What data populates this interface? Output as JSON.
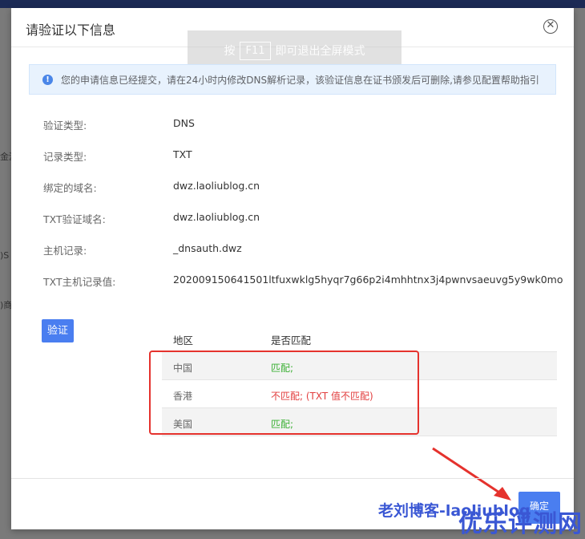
{
  "dialog": {
    "title": "请验证以下信息",
    "close_icon": "close-icon"
  },
  "fullscreen_tip": {
    "prefix": "按",
    "key": "F11",
    "suffix": "即可退出全屏模式"
  },
  "info_bar": {
    "icon": "info-icon",
    "text": "您的申请信息已经提交，请在24小时内修改DNS解析记录，该验证信息在证书颁发后可删除,请参见配置帮助指引"
  },
  "fields": [
    {
      "label": "验证类型:",
      "value": "DNS"
    },
    {
      "label": "记录类型:",
      "value": "TXT"
    },
    {
      "label": "绑定的域名:",
      "value": "dwz.laoliublog.cn"
    },
    {
      "label": "TXT验证域名:",
      "value": "dwz.laoliublog.cn"
    },
    {
      "label": "主机记录:",
      "value": "_dnsauth.dwz"
    },
    {
      "label": "TXT主机记录值:",
      "value": "202009150641501ltfuxwklg5hyqr7g66p2i4mhhtnx3j4pwnvsaeuvg5y9wk0mo"
    }
  ],
  "verify_button": "验证",
  "results_table": {
    "headers": [
      "地区",
      "是否匹配"
    ],
    "rows": [
      {
        "region": "中国",
        "status": "匹配;",
        "matched": true
      },
      {
        "region": "香港",
        "status": "不匹配; (TXT 值不匹配)",
        "matched": false
      },
      {
        "region": "美国",
        "status": "匹配;",
        "matched": true
      }
    ]
  },
  "confirm_button": "确定",
  "watermark": {
    "line1": "老刘博客-laoliublog",
    "line2": "优乐评测网"
  },
  "background_fragments": {
    "left1": "金源",
    "left2": ")S",
    "left3": ")商"
  },
  "colors": {
    "primary": "#4a7ef0",
    "match": "#3cb035",
    "nomatch": "#e23e3e",
    "annotation": "#e5322d"
  }
}
